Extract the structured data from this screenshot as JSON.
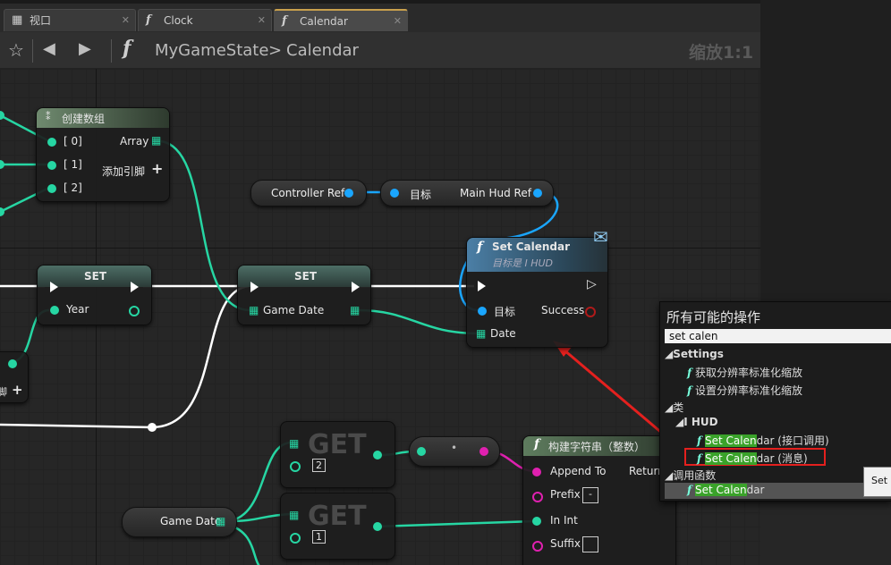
{
  "tabs": [
    {
      "label": "视口",
      "icon": "viewport-icon"
    },
    {
      "label": "Clock",
      "icon": "function-icon"
    },
    {
      "label": "Calendar",
      "icon": "function-icon"
    }
  ],
  "breadcrumb": {
    "parent": "MyGameState",
    "separator": ">",
    "current": "Calendar"
  },
  "zoom_label": "缩放1:1",
  "nodes": {
    "make_array": {
      "title": "创建数组",
      "pins": [
        "[ 0]",
        "[ 1]",
        "[ 2]"
      ],
      "output": "Array",
      "add_pin": "添加引脚"
    },
    "set_year": {
      "title": "SET",
      "pin": "Year"
    },
    "set_game_date": {
      "title": "SET",
      "pin": "Game Date"
    },
    "controller_ref": {
      "label": "Controller Ref"
    },
    "main_hud_ref": {
      "target": "目标",
      "output": "Main Hud Ref"
    },
    "set_calendar": {
      "title": "Set Calendar",
      "subtitle": "目标是 I HUD",
      "target": "目标",
      "success": "Success",
      "date": "Date"
    },
    "get1": {
      "label": "GET",
      "index": "2"
    },
    "get2": {
      "label": "GET",
      "index": "1"
    },
    "game_date_var": {
      "label": "Game Date"
    },
    "build_string": {
      "title": "构建字符串（整数）",
      "append_to": "Append To",
      "return": "Return",
      "prefix": "Prefix",
      "prefix_value": "-",
      "in_int": "In Int",
      "suffix": "Suffix"
    },
    "partial_add_pin": "脚"
  },
  "context_menu": {
    "title": "所有可能的操作",
    "search_value": "set calen",
    "sections": [
      {
        "label": "Settings",
        "items": [
          "获取分辨率标准化缩放",
          "设置分辨率标准化缩放"
        ]
      },
      {
        "label": "类",
        "sub": "I HUD",
        "items": [
          {
            "match": "Set Calen",
            "rest": "dar (接口调用)"
          },
          {
            "match": "Set Calen",
            "rest": "dar (消息)"
          }
        ]
      },
      {
        "label": "调用函数",
        "items": [
          {
            "match": "Set Calen",
            "rest": "dar"
          }
        ]
      }
    ]
  },
  "tooltip_text": "Set C",
  "colors": {
    "accent_tab": "#c9a04d",
    "pin_teal": "#26d6a3",
    "pin_blue": "#1aa6ff",
    "pin_magenta": "#e020b0",
    "highlight_red": "#e4201e",
    "match_green": "#3aa22a"
  }
}
